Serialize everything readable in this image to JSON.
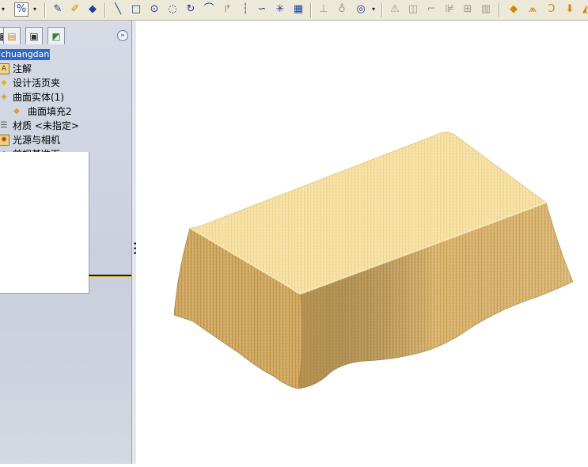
{
  "toolbar": {
    "icons": [
      "menu-dropdown-icon",
      "percent-icon",
      "sketch-icon",
      "3d-sketch-icon",
      "smart-dimension-icon",
      "line-icon",
      "rectangle-icon",
      "circle-icon",
      "centerpoint-arc-icon",
      "tangent-arc-icon",
      "three-point-arc-icon",
      "fillet-sketch-icon",
      "centerline-icon",
      "spline-icon",
      "point-icon",
      "grid-icon",
      "reference-plane-icon",
      "reference-axis-icon",
      "coordinate-system-icon",
      "draft-icon",
      "offset-surface-icon",
      "trim-icon",
      "mirror-icon",
      "linear-pattern-icon",
      "shell-icon",
      "extrude-surface-icon",
      "revolve-surface-icon",
      "sweep-surface-icon",
      "loft-surface-icon"
    ]
  },
  "feature_tree": {
    "root": "chuangdan",
    "items": [
      {
        "label": "注解",
        "icon": "annotations-icon",
        "indent": 0
      },
      {
        "label": "设计活页夹",
        "icon": "design-binder-icon",
        "indent": 0
      },
      {
        "label": "曲面实体(1)",
        "icon": "surface-bodies-icon",
        "indent": 0
      },
      {
        "label": "曲面填充2",
        "icon": "filled-surface-icon",
        "indent": 1
      },
      {
        "label": "材质 <未指定>",
        "icon": "material-icon",
        "indent": 0
      },
      {
        "label": "光源与相机",
        "icon": "lights-cameras-icon",
        "indent": 0
      },
      {
        "label": "前视基准面",
        "icon": "front-plane-icon",
        "indent": 0
      }
    ]
  },
  "model": {
    "name": "chuangdan",
    "top_color": "#f5dd9a",
    "side_color": "#c9a45c"
  }
}
